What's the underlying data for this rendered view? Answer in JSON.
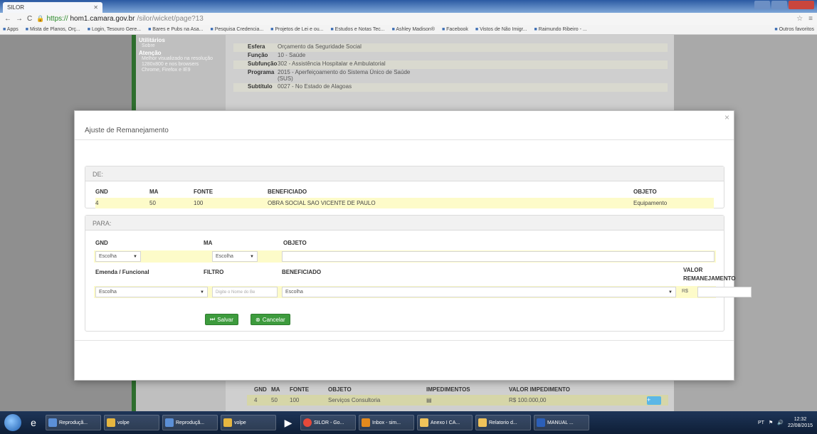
{
  "browser": {
    "tab_title": "SILOR",
    "url_protocol": "https://",
    "url_host": "hom1.camara.gov.br",
    "url_path": "/silor/wicket/page?13",
    "bookmarks": [
      "Apps",
      "Mista de Planos, Orç...",
      "Login, Tesouro Gere...",
      "Bares e Pubs na Asa...",
      "Pesquisa Credencia...",
      "Projetos de Lei e ou...",
      "Estudos e Notas Tec...",
      "Ashley Madison®",
      "Facebook",
      "Vistos de Não Imigr...",
      "Raimundo Ribeiro - ..."
    ],
    "bookmarks_other": "Outros favoritos"
  },
  "sidebar": {
    "utilitarios": "Utilitários",
    "sobre": "Sobre",
    "atencao": "Atenção",
    "atencao_text": "Melhor visualizado na resolução 1280x800 e nos browsers Chrome, Firefox e IE9"
  },
  "info": [
    {
      "k": "Esfera",
      "v": "Orçamento da Seguridade Social"
    },
    {
      "k": "Função",
      "v": "10 - Saúde"
    },
    {
      "k": "Subfunção",
      "v": "302 - Assistência Hospitalar e Ambulatorial"
    },
    {
      "k": "Programa",
      "v": "2015 - Aperfeiçoamento do Sistema Único de Saúde (SUS)"
    },
    {
      "k": "Subtítulo",
      "v": "0027 - No Estado de Alagoas"
    }
  ],
  "bottom_table": {
    "headers": [
      "GND",
      "MA",
      "FONTE",
      "OBJETO",
      "IMPEDIMENTOS",
      "VALOR IMPEDIMENTO"
    ],
    "row": [
      "4",
      "50",
      "100",
      "Serviços Consultoria",
      "",
      "R$ 100.000,00"
    ],
    "add_label": "+"
  },
  "modal": {
    "title": "Ajuste de Remanejamento",
    "close": "×",
    "de": {
      "heading": "DE:",
      "headers": [
        "GND",
        "MA",
        "FONTE",
        "BENEFICIADO",
        "OBJETO"
      ],
      "row": [
        "4",
        "50",
        "100",
        "OBRA SOCIAL SAO VICENTE DE PAULO",
        "Equipamento"
      ]
    },
    "para": {
      "heading": "PARA:",
      "gnd_label": "GND",
      "ma_label": "MA",
      "objeto_label": "OBJETO",
      "gnd_value": "Escolha",
      "ma_value": "Escolha",
      "objeto_value": "",
      "emenda_label": "Emenda / Funcional",
      "filtro_label": "FILTRO",
      "beneficiado_label": "BENEFICIADO",
      "valor_label": "VALOR",
      "remanejamento_label": "REMANEJAMENTO",
      "emenda_value": "Escolha",
      "filtro_placeholder": "Digite o Nome do Be",
      "beneficiado_value": "Escolha",
      "currency": "R$",
      "valor_value": ""
    },
    "save_label": "Salvar",
    "cancel_label": "Cancelar"
  },
  "taskbar": {
    "items": [
      "Reproduçã...",
      "volpe",
      "Reproduçã...",
      "volpe",
      "",
      "SILOR - Go...",
      "Inbox - sim...",
      "Anexo I CA...",
      "Relatorio d...",
      "MANUAL ..."
    ],
    "lang": "PT",
    "time": "12:32",
    "date": "22/08/2015"
  },
  "colors": {
    "accent_green": "#3d9b3d",
    "row_highlight": "#fdfbc9",
    "sidebar_green": "#2e6e2e"
  }
}
